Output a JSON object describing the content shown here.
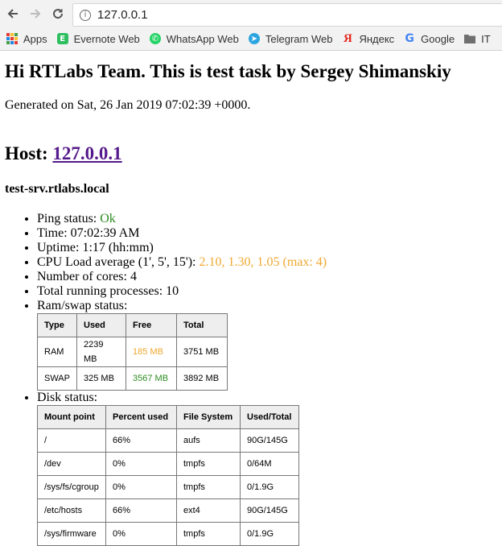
{
  "browser": {
    "address": "127.0.0.1",
    "bookmarks": [
      "Apps",
      "Evernote Web",
      "WhatsApp Web",
      "Telegram Web",
      "Яндекс",
      "Google",
      "IT"
    ]
  },
  "page": {
    "title": "Hi RTLabs Team. This is test task by Sergey Shimanskiy",
    "generated": "Generated on Sat, 26 Jan 2019 07:02:39 +0000.",
    "host_label": "Host:",
    "host_link": "127.0.0.1",
    "hostname": "test-srv.rtlabs.local",
    "status": {
      "ping_label": "Ping status: ",
      "ping_value": "Ok",
      "time": "Time: 07:02:39 AM",
      "uptime": "Uptime: 1:17 (hh:mm)",
      "cpu_label": "CPU Load average (1', 5', 15'): ",
      "cpu_value": "2.10, 1.30, 1.05 (max: 4)",
      "cores": "Number of cores: 4",
      "processes": "Total running processes: 10",
      "ram_label": "Ram/swap status:",
      "disk_label": "Disk status:"
    },
    "ram_table": {
      "headers": [
        "Type",
        "Used",
        "Free",
        "Total"
      ],
      "rows": [
        [
          "RAM",
          "2239 MB",
          "185 MB",
          "3751 MB"
        ],
        [
          "SWAP",
          "325 MB",
          "3567 MB",
          "3892 MB"
        ]
      ]
    },
    "disk_table": {
      "headers": [
        "Mount point",
        "Percent used",
        "File System",
        "Used/Total"
      ],
      "rows": [
        [
          "/",
          "66%",
          "aufs",
          "90G/145G"
        ],
        [
          "/dev",
          "0%",
          "tmpfs",
          "0/64M"
        ],
        [
          "/sys/fs/cgroup",
          "0%",
          "tmpfs",
          "0/1.9G"
        ],
        [
          "/etc/hosts",
          "66%",
          "ext4",
          "90G/145G"
        ],
        [
          "/sys/firmware",
          "0%",
          "tmpfs",
          "0/1.9G"
        ]
      ]
    }
  },
  "colors": {
    "ok": "#2e8b22",
    "warn": "#f0a830",
    "link": "#551a8b"
  }
}
